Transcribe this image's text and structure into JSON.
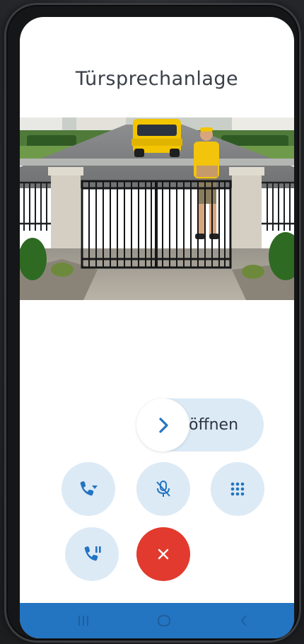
{
  "header": {
    "title": "Türsprechanlage"
  },
  "camera": {
    "icon": "door-camera-feed"
  },
  "door_slider": {
    "label": "öffnen",
    "icon": "chevron-right-icon"
  },
  "controls": [
    {
      "name": "call-transfer-button",
      "icon": "phone-forward-icon"
    },
    {
      "name": "mute-button",
      "icon": "mic-off-icon"
    },
    {
      "name": "keypad-button",
      "icon": "dialpad-icon"
    },
    {
      "name": "hold-button",
      "icon": "phone-pause-icon"
    },
    {
      "name": "hangup-button",
      "icon": "close-icon"
    }
  ],
  "nav": {
    "recents": "recents-icon",
    "home": "home-icon",
    "back": "back-icon"
  },
  "colors": {
    "accent": "#2374c1",
    "button_bg": "#dceaf6",
    "hangup": "#e23a2e",
    "title": "#3a4048"
  }
}
